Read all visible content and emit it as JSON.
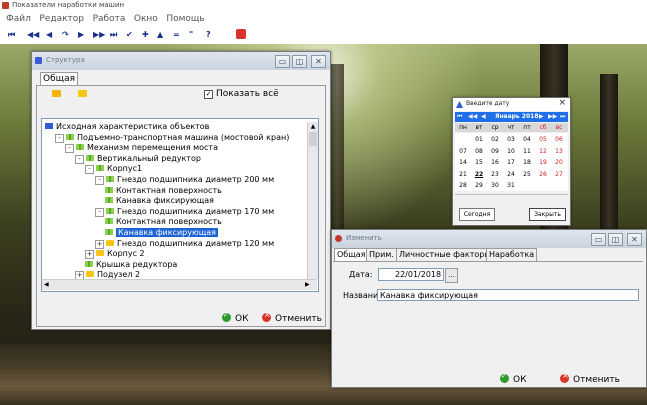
{
  "app": {
    "title": "Показатели наработки машин"
  },
  "menu": [
    "Файл",
    "Редактор",
    "Работа",
    "Окно",
    "Помощь"
  ],
  "toolbar": [
    "⏮",
    "◀◀",
    "◀",
    "↷",
    "▶",
    "▶▶",
    "⏭",
    "✔",
    "✚",
    "▲",
    "=",
    "\"",
    "?"
  ],
  "structure_window": {
    "title": "Структура",
    "tab": "Общая",
    "show_all_label": "Показать всё",
    "show_all_checked": true,
    "tree": [
      {
        "label": "Исходная характеристика объектов",
        "depth": 0,
        "icon": "blue",
        "toggle": ""
      },
      {
        "label": "Подъемно-транспортная машина (мостовой кран)",
        "depth": 1,
        "icon": "green",
        "toggle": "-"
      },
      {
        "label": "Механизм перемещения моста",
        "depth": 2,
        "icon": "green",
        "toggle": "-"
      },
      {
        "label": "Вертикальный редуктор",
        "depth": 3,
        "icon": "green",
        "toggle": "-"
      },
      {
        "label": "Корпус1",
        "depth": 4,
        "icon": "green",
        "toggle": "-"
      },
      {
        "label": "Гнездо подшипника диаметр 200 мм",
        "depth": 5,
        "icon": "green",
        "toggle": "-"
      },
      {
        "label": "Контактная поверхность",
        "depth": 6,
        "icon": "green",
        "toggle": ""
      },
      {
        "label": "Канавка фиксирующая",
        "depth": 6,
        "icon": "green",
        "toggle": ""
      },
      {
        "label": "Гнездо подшипника диаметр 170 мм",
        "depth": 5,
        "icon": "green",
        "toggle": "-"
      },
      {
        "label": "Контактная поверхность",
        "depth": 6,
        "icon": "green",
        "toggle": ""
      },
      {
        "label": "Канавка фиксирующая",
        "depth": 6,
        "icon": "green",
        "toggle": "",
        "selected": true
      },
      {
        "label": "Гнездо подшипника диаметр 120 мм",
        "depth": 5,
        "icon": "yellow",
        "toggle": "+"
      },
      {
        "label": "Корпус 2",
        "depth": 4,
        "icon": "yellow",
        "toggle": "+"
      },
      {
        "label": "Крышка редуктора",
        "depth": 4,
        "icon": "green",
        "toggle": ""
      },
      {
        "label": "Подузел 2",
        "depth": 3,
        "icon": "yellow",
        "toggle": "+"
      }
    ],
    "ok_label": "ОК",
    "cancel_label": "Отменить"
  },
  "calendar": {
    "title": "Введите дату",
    "month_label": "Январь 2018",
    "days": [
      "пн",
      "вт",
      "ср",
      "чт",
      "пт",
      "сб",
      "вс"
    ],
    "weeks": [
      [
        "",
        "01",
        "02",
        "03",
        "04",
        "05",
        "06"
      ],
      [
        "07",
        "08",
        "09",
        "10",
        "11",
        "12",
        "13"
      ],
      [
        "14",
        "15",
        "16",
        "17",
        "18",
        "19",
        "20"
      ],
      [
        "21",
        "22",
        "23",
        "24",
        "25",
        "26",
        "27"
      ],
      [
        "28",
        "29",
        "30",
        "31",
        "",
        "",
        ""
      ]
    ],
    "today_label": "Сегодня",
    "close_label": "Закрыть"
  },
  "edit_window": {
    "title": "Изменить",
    "tabs": [
      "Общая",
      "Прим.",
      "Личностные факторы",
      "Наработка"
    ],
    "date_label": "Дата:",
    "date_value": "22/01/2018",
    "name_label": "Название:",
    "name_value": "Канавка фиксирующая",
    "ok_label": "ОК",
    "cancel_label": "Отменить"
  }
}
